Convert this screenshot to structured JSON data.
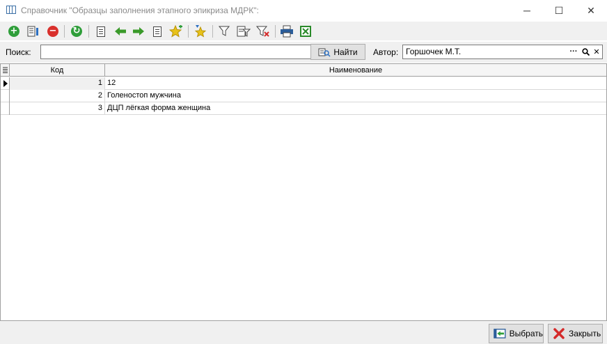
{
  "window": {
    "title": "Справочник \"Образцы заполнения этапного эпикриза МДРК\":",
    "controls": {
      "minimize": "─",
      "maximize": "☐",
      "close": "✕"
    }
  },
  "toolbar": {
    "buttons": [
      {
        "icon": "add-icon",
        "glyph": "+",
        "color": "#2f9e3a"
      },
      {
        "icon": "edit-record-icon"
      },
      {
        "icon": "delete-icon",
        "glyph": "−",
        "color": "#d9302c"
      },
      {
        "icon": "refresh-icon",
        "glyph": "↻",
        "color": "#2f9e3a"
      },
      {
        "icon": "list-icon"
      },
      {
        "icon": "arrow-left-icon",
        "glyph": "⬅",
        "color": "#3a9a2a"
      },
      {
        "icon": "arrow-right-icon",
        "glyph": "➡",
        "color": "#3a9a2a"
      },
      {
        "icon": "copy-record-icon"
      },
      {
        "icon": "add-favorite-icon",
        "glyph": "★",
        "color": "#e8c21a"
      },
      {
        "icon": "favorite-down-icon",
        "glyph": "★",
        "color": "#e8c21a"
      },
      {
        "icon": "filter-icon",
        "glyph": "▼"
      },
      {
        "icon": "filter-edit-icon"
      },
      {
        "icon": "filter-clear-icon",
        "glyph": "▼"
      },
      {
        "icon": "print-icon",
        "glyph": "🖶",
        "color": "#2b5d9a"
      },
      {
        "icon": "excel-icon",
        "glyph": "✕",
        "color": "#2a8a2a"
      }
    ]
  },
  "search": {
    "label": "Поиск:",
    "value": "",
    "find_button": "Найти",
    "author_label": "Автор:",
    "author_value": "Горшочек М.Т.",
    "author_more": "···",
    "author_lookup": "🔍",
    "author_clear": "✕"
  },
  "grid": {
    "columns": {
      "code": "Код",
      "name": "Наименование"
    },
    "rows": [
      {
        "code": "1",
        "name": "12",
        "current": true
      },
      {
        "code": "2",
        "name": "Голеностоп мужчина"
      },
      {
        "code": "3",
        "name": "ДЦП лёгкая форма женщина"
      }
    ]
  },
  "footer": {
    "select_button": "Выбрать",
    "close_button": "Закрыть"
  },
  "colors": {
    "toolbar_bg": "#f0f0f0",
    "green": "#2f9e3a",
    "red": "#d9302c",
    "close_x": "#d42a2a"
  }
}
